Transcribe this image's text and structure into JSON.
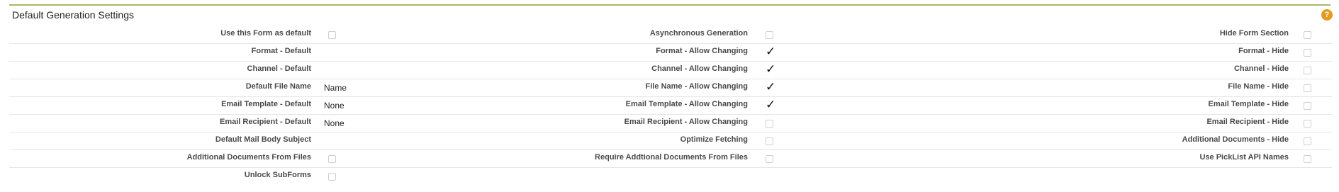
{
  "section": {
    "title": "Default Generation Settings",
    "help_icon": "?"
  },
  "rows": [
    {
      "col1": {
        "label": "Use this Form as default",
        "type": "checkbox",
        "checked": false
      },
      "col2": {
        "label": "Asynchronous Generation",
        "type": "checkbox",
        "checked": false
      },
      "col3": {
        "label": "Hide Form Section",
        "type": "checkbox",
        "checked": false
      }
    },
    {
      "col1": {
        "label": "Format - Default",
        "type": "text",
        "value": ""
      },
      "col2": {
        "label": "Format - Allow Changing",
        "type": "check",
        "checked": true,
        "glyph": "✓"
      },
      "col3": {
        "label": "Format - Hide",
        "type": "checkbox",
        "checked": false
      }
    },
    {
      "col1": {
        "label": "Channel - Default",
        "type": "text",
        "value": ""
      },
      "col2": {
        "label": "Channel - Allow Changing",
        "type": "check",
        "checked": true,
        "glyph": "✓"
      },
      "col3": {
        "label": "Channel - Hide",
        "type": "checkbox",
        "checked": false
      }
    },
    {
      "col1": {
        "label": "Default File Name",
        "type": "text",
        "value": "Name"
      },
      "col2": {
        "label": "File Name - Allow Changing",
        "type": "check",
        "checked": true,
        "glyph": "✓"
      },
      "col3": {
        "label": "File Name - Hide",
        "type": "checkbox",
        "checked": false
      }
    },
    {
      "col1": {
        "label": "Email Template - Default",
        "type": "text",
        "value": "None"
      },
      "col2": {
        "label": "Email Template - Allow Changing",
        "type": "check",
        "checked": true,
        "glyph": "✓"
      },
      "col3": {
        "label": "Email Template - Hide",
        "type": "checkbox",
        "checked": false
      }
    },
    {
      "col1": {
        "label": "Email Recipient - Default",
        "type": "text",
        "value": "None"
      },
      "col2": {
        "label": "Email Recipient - Allow Changing",
        "type": "checkbox",
        "checked": false
      },
      "col3": {
        "label": "Email Recipient - Hide",
        "type": "checkbox",
        "checked": false
      }
    },
    {
      "col1": {
        "label": "Default Mail Body Subject",
        "type": "text",
        "value": ""
      },
      "col2": {
        "label": "Optimize Fetching",
        "type": "checkbox",
        "checked": false
      },
      "col3": {
        "label": "Additional Documents - Hide",
        "type": "checkbox",
        "checked": false
      }
    },
    {
      "col1": {
        "label": "Additional Documents From Files",
        "type": "checkbox",
        "checked": false
      },
      "col2": {
        "label": "Require Addtional Documents From Files",
        "type": "checkbox",
        "checked": false
      },
      "col3": {
        "label": "Use PickList API Names",
        "type": "checkbox",
        "checked": false
      }
    },
    {
      "col1": {
        "label": "Unlock SubForms",
        "type": "checkbox",
        "checked": false
      },
      "col2": null,
      "col3": null
    }
  ],
  "colors": {
    "accent_border": "#a4b86a",
    "help_badge": "#e39a1f"
  }
}
